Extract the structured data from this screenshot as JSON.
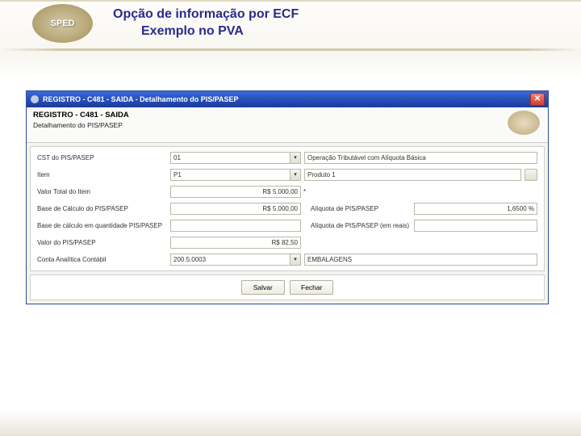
{
  "slide": {
    "title_line1": "Opção de informação por ECF",
    "title_line2": "Exemplo no PVA",
    "logo_text": "SPED"
  },
  "window": {
    "title": "REGISTRO - C481 - SAIDA - Detalhamento do PIS/PASEP"
  },
  "header": {
    "title": "REGISTRO - C481 - SAIDA",
    "subtitle": "Detalhamento do PIS/PASEP"
  },
  "labels": {
    "cst": "CST do PIS/PASEP",
    "item": "Item",
    "valorTotal": "Valor Total do Item",
    "baseCalc": "Base de Cálculo do PIS/PASEP",
    "baseCalcQtd": "Base de cálculo em quantidade PIS/PASEP",
    "valorPis": "Valor do PIS/PASEP",
    "conta": "Conta Analítica Contábil",
    "aliquota": "Alíquota de PIS/PASEP",
    "aliquotaReais": "Alíquota de PIS/PASEP (em reais)"
  },
  "values": {
    "cst_code": "01",
    "cst_desc": "Operação Tributável com Alíquota Básica",
    "item_code": "P1",
    "item_desc": "Produto 1",
    "valorTotal": "R$ 5.000,00",
    "baseCalc": "R$ 5.000,00",
    "baseCalcQtd": "",
    "valorPis": "R$ 82,50",
    "conta_code": "200.5.0003",
    "conta_desc": "EMBALAGENS",
    "aliquota": "1,6500 %",
    "aliquotaReais": ""
  },
  "buttons": {
    "save": "Salvar",
    "close": "Fechar"
  }
}
